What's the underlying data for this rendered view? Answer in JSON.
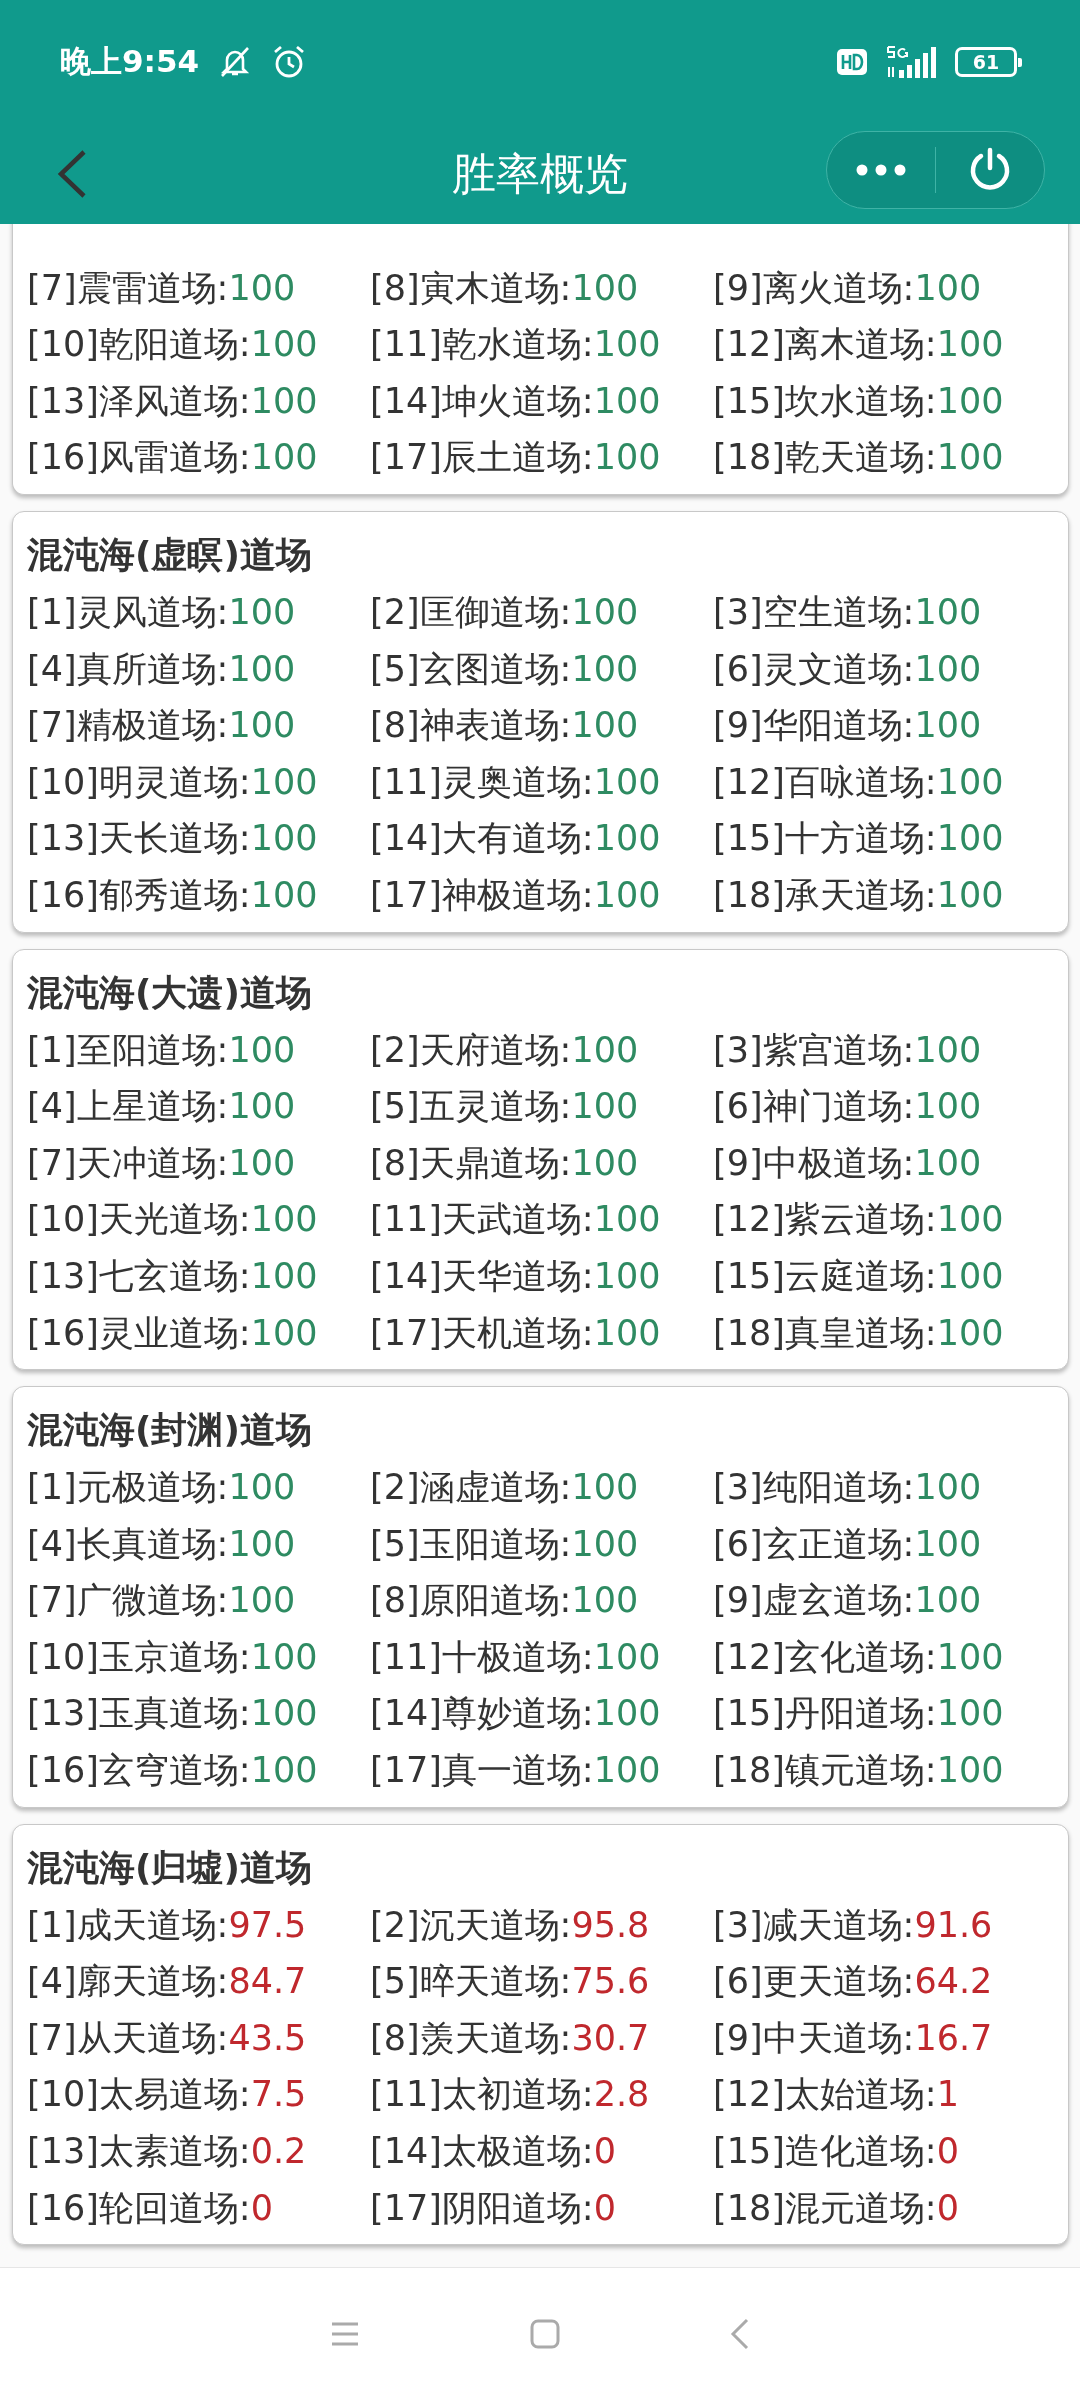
{
  "status_bar": {
    "time": "晚上9:54",
    "battery": "61"
  },
  "header": {
    "title": "胜率概览"
  },
  "sections": [
    {
      "items": [
        {
          "label": "[7]震雷道场:",
          "value": "100",
          "color": "#2e8b62"
        },
        {
          "label": "[8]寅木道场:",
          "value": "100",
          "color": "#2e8b62"
        },
        {
          "label": "[9]离火道场:",
          "value": "100",
          "color": "#2e8b62"
        },
        {
          "label": "[10]乾阳道场:",
          "value": "100",
          "color": "#2e8b62"
        },
        {
          "label": "[11]乾水道场:",
          "value": "100",
          "color": "#2e8b62"
        },
        {
          "label": "[12]离木道场:",
          "value": "100",
          "color": "#2e8b62"
        },
        {
          "label": "[13]泽风道场:",
          "value": "100",
          "color": "#2e8b62"
        },
        {
          "label": "[14]坤火道场:",
          "value": "100",
          "color": "#2e8b62"
        },
        {
          "label": "[15]坎水道场:",
          "value": "100",
          "color": "#2e8b62"
        },
        {
          "label": "[16]风雷道场:",
          "value": "100",
          "color": "#2e8b62"
        },
        {
          "label": "[17]辰土道场:",
          "value": "100",
          "color": "#2e8b62"
        },
        {
          "label": "[18]乾天道场:",
          "value": "100",
          "color": "#2e8b62"
        }
      ]
    },
    {
      "title": "混沌海(虚瞑)道场",
      "items": [
        {
          "label": "[1]灵风道场:",
          "value": "100",
          "color": "#2e8b62"
        },
        {
          "label": "[2]匡御道场:",
          "value": "100",
          "color": "#2e8b62"
        },
        {
          "label": "[3]空生道场:",
          "value": "100",
          "color": "#2e8b62"
        },
        {
          "label": "[4]真所道场:",
          "value": "100",
          "color": "#2e8b62"
        },
        {
          "label": "[5]玄图道场:",
          "value": "100",
          "color": "#2e8b62"
        },
        {
          "label": "[6]灵文道场:",
          "value": "100",
          "color": "#2e8b62"
        },
        {
          "label": "[7]精极道场:",
          "value": "100",
          "color": "#2e8b62"
        },
        {
          "label": "[8]神表道场:",
          "value": "100",
          "color": "#2e8b62"
        },
        {
          "label": "[9]华阳道场:",
          "value": "100",
          "color": "#2e8b62"
        },
        {
          "label": "[10]明灵道场:",
          "value": "100",
          "color": "#2e8b62"
        },
        {
          "label": "[11]灵奥道场:",
          "value": "100",
          "color": "#2e8b62"
        },
        {
          "label": "[12]百咏道场:",
          "value": "100",
          "color": "#2e8b62"
        },
        {
          "label": "[13]天长道场:",
          "value": "100",
          "color": "#2e8b62"
        },
        {
          "label": "[14]大有道场:",
          "value": "100",
          "color": "#2e8b62"
        },
        {
          "label": "[15]十方道场:",
          "value": "100",
          "color": "#2e8b62"
        },
        {
          "label": "[16]郁秀道场:",
          "value": "100",
          "color": "#2e8b62"
        },
        {
          "label": "[17]神极道场:",
          "value": "100",
          "color": "#2e8b62"
        },
        {
          "label": "[18]承天道场:",
          "value": "100",
          "color": "#2e8b62"
        }
      ]
    },
    {
      "title": "混沌海(大遗)道场",
      "items": [
        {
          "label": "[1]至阳道场:",
          "value": "100",
          "color": "#2e8b62"
        },
        {
          "label": "[2]天府道场:",
          "value": "100",
          "color": "#2e8b62"
        },
        {
          "label": "[3]紫宫道场:",
          "value": "100",
          "color": "#2e8b62"
        },
        {
          "label": "[4]上星道场:",
          "value": "100",
          "color": "#2e8b62"
        },
        {
          "label": "[5]五灵道场:",
          "value": "100",
          "color": "#2e8b62"
        },
        {
          "label": "[6]神门道场:",
          "value": "100",
          "color": "#2e8b62"
        },
        {
          "label": "[7]天冲道场:",
          "value": "100",
          "color": "#2e8b62"
        },
        {
          "label": "[8]天鼎道场:",
          "value": "100",
          "color": "#2e8b62"
        },
        {
          "label": "[9]中极道场:",
          "value": "100",
          "color": "#2e8b62"
        },
        {
          "label": "[10]天光道场:",
          "value": "100",
          "color": "#2e8b62"
        },
        {
          "label": "[11]天武道场:",
          "value": "100",
          "color": "#2e8b62"
        },
        {
          "label": "[12]紫云道场:",
          "value": "100",
          "color": "#2e8b62"
        },
        {
          "label": "[13]七玄道场:",
          "value": "100",
          "color": "#2e8b62"
        },
        {
          "label": "[14]天华道场:",
          "value": "100",
          "color": "#2e8b62"
        },
        {
          "label": "[15]云庭道场:",
          "value": "100",
          "color": "#2e8b62"
        },
        {
          "label": "[16]灵业道场:",
          "value": "100",
          "color": "#2e8b62"
        },
        {
          "label": "[17]天机道场:",
          "value": "100",
          "color": "#2e8b62"
        },
        {
          "label": "[18]真皇道场:",
          "value": "100",
          "color": "#2e8b62"
        }
      ]
    },
    {
      "title": "混沌海(封渊)道场",
      "items": [
        {
          "label": "[1]元极道场:",
          "value": "100",
          "color": "#2e8b62"
        },
        {
          "label": "[2]涵虚道场:",
          "value": "100",
          "color": "#2e8b62"
        },
        {
          "label": "[3]纯阳道场:",
          "value": "100",
          "color": "#2e8b62"
        },
        {
          "label": "[4]长真道场:",
          "value": "100",
          "color": "#2e8b62"
        },
        {
          "label": "[5]玉阳道场:",
          "value": "100",
          "color": "#2e8b62"
        },
        {
          "label": "[6]玄正道场:",
          "value": "100",
          "color": "#2e8b62"
        },
        {
          "label": "[7]广微道场:",
          "value": "100",
          "color": "#2e8b62"
        },
        {
          "label": "[8]原阳道场:",
          "value": "100",
          "color": "#2e8b62"
        },
        {
          "label": "[9]虚玄道场:",
          "value": "100",
          "color": "#2e8b62"
        },
        {
          "label": "[10]玉京道场:",
          "value": "100",
          "color": "#2e8b62"
        },
        {
          "label": "[11]十极道场:",
          "value": "100",
          "color": "#2e8b62"
        },
        {
          "label": "[12]玄化道场:",
          "value": "100",
          "color": "#2e8b62"
        },
        {
          "label": "[13]玉真道场:",
          "value": "100",
          "color": "#2e8b62"
        },
        {
          "label": "[14]尊妙道场:",
          "value": "100",
          "color": "#2e8b62"
        },
        {
          "label": "[15]丹阳道场:",
          "value": "100",
          "color": "#2e8b62"
        },
        {
          "label": "[16]玄穹道场:",
          "value": "100",
          "color": "#2e8b62"
        },
        {
          "label": "[17]真一道场:",
          "value": "100",
          "color": "#2e8b62"
        },
        {
          "label": "[18]镇元道场:",
          "value": "100",
          "color": "#2e8b62"
        }
      ]
    },
    {
      "title": "混沌海(归墟)道场",
      "items": [
        {
          "label": "[1]成天道场:",
          "value": "97.5",
          "color": "#c0282d"
        },
        {
          "label": "[2]沉天道场:",
          "value": "95.8",
          "color": "#c0282d"
        },
        {
          "label": "[3]减天道场:",
          "value": "91.6",
          "color": "#c0282d"
        },
        {
          "label": "[4]廓天道场:",
          "value": "84.7",
          "color": "#c0282d"
        },
        {
          "label": "[5]晬天道场:",
          "value": "75.6",
          "color": "#c0282d"
        },
        {
          "label": "[6]更天道场:",
          "value": "64.2",
          "color": "#c0282d"
        },
        {
          "label": "[7]从天道场:",
          "value": "43.5",
          "color": "#c0282d"
        },
        {
          "label": "[8]羡天道场:",
          "value": "30.7",
          "color": "#c0282d"
        },
        {
          "label": "[9]中天道场:",
          "value": "16.7",
          "color": "#c0282d"
        },
        {
          "label": "[10]太易道场:",
          "value": "7.5",
          "color": "#c0282d"
        },
        {
          "label": "[11]太初道场:",
          "value": "2.8",
          "color": "#c0282d"
        },
        {
          "label": "[12]太始道场:",
          "value": "1",
          "color": "#c0282d"
        },
        {
          "label": "[13]太素道场:",
          "value": "0.2",
          "color": "#c0282d"
        },
        {
          "label": "[14]太极道场:",
          "value": "0",
          "color": "#c0282d"
        },
        {
          "label": "[15]造化道场:",
          "value": "0",
          "color": "#c0282d"
        },
        {
          "label": "[16]轮回道场:",
          "value": "0",
          "color": "#c0282d"
        },
        {
          "label": "[17]阴阳道场:",
          "value": "0",
          "color": "#c0282d"
        },
        {
          "label": "[18]混元道场:",
          "value": "0",
          "color": "#c0282d"
        }
      ]
    }
  ]
}
